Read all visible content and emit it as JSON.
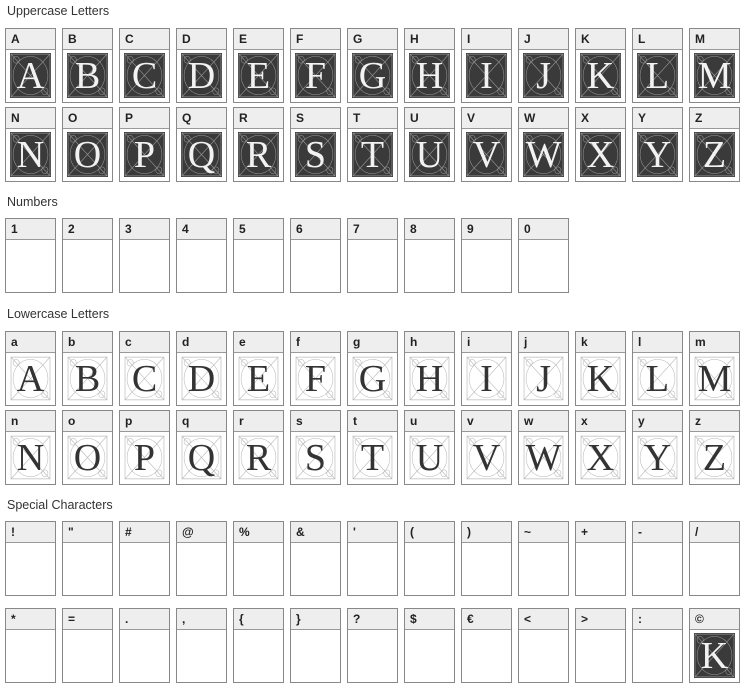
{
  "sections": [
    {
      "title": "Uppercase Letters",
      "kind": "upper",
      "cells": [
        [
          "A",
          "A"
        ],
        [
          "B",
          "B"
        ],
        [
          "C",
          "C"
        ],
        [
          "D",
          "D"
        ],
        [
          "E",
          "E"
        ],
        [
          "F",
          "F"
        ],
        [
          "G",
          "G"
        ],
        [
          "H",
          "H"
        ],
        [
          "I",
          "I"
        ],
        [
          "J",
          "J"
        ],
        [
          "K",
          "K"
        ],
        [
          "L",
          "L"
        ],
        [
          "M",
          "M"
        ],
        [
          "N",
          "N"
        ],
        [
          "O",
          "O"
        ],
        [
          "P",
          "P"
        ],
        [
          "Q",
          "Q"
        ],
        [
          "R",
          "R"
        ],
        [
          "S",
          "S"
        ],
        [
          "T",
          "T"
        ],
        [
          "U",
          "U"
        ],
        [
          "V",
          "V"
        ],
        [
          "W",
          "W"
        ],
        [
          "X",
          "X"
        ],
        [
          "Y",
          "Y"
        ],
        [
          "Z",
          "Z"
        ]
      ]
    },
    {
      "title": "Numbers",
      "kind": "empty",
      "cells": [
        [
          "1",
          ""
        ],
        [
          "2",
          ""
        ],
        [
          "3",
          ""
        ],
        [
          "4",
          ""
        ],
        [
          "5",
          ""
        ],
        [
          "6",
          ""
        ],
        [
          "7",
          ""
        ],
        [
          "8",
          ""
        ],
        [
          "9",
          ""
        ],
        [
          "0",
          ""
        ]
      ]
    },
    {
      "title": "Lowercase Letters",
      "kind": "lower",
      "cells": [
        [
          "a",
          "A"
        ],
        [
          "b",
          "B"
        ],
        [
          "c",
          "C"
        ],
        [
          "d",
          "D"
        ],
        [
          "e",
          "E"
        ],
        [
          "f",
          "F"
        ],
        [
          "g",
          "G"
        ],
        [
          "h",
          "H"
        ],
        [
          "i",
          "I"
        ],
        [
          "j",
          "J"
        ],
        [
          "k",
          "K"
        ],
        [
          "l",
          "L"
        ],
        [
          "m",
          "M"
        ],
        [
          "n",
          "N"
        ],
        [
          "o",
          "O"
        ],
        [
          "p",
          "P"
        ],
        [
          "q",
          "Q"
        ],
        [
          "r",
          "R"
        ],
        [
          "s",
          "S"
        ],
        [
          "t",
          "T"
        ],
        [
          "u",
          "U"
        ],
        [
          "v",
          "V"
        ],
        [
          "w",
          "W"
        ],
        [
          "x",
          "X"
        ],
        [
          "y",
          "Y"
        ],
        [
          "z",
          "Z"
        ]
      ]
    },
    {
      "title": "Special Characters",
      "kind": "special",
      "cells": [
        [
          "!",
          ""
        ],
        [
          "\"",
          ""
        ],
        [
          "#",
          ""
        ],
        [
          "@",
          ""
        ],
        [
          "%",
          ""
        ],
        [
          "&",
          ""
        ],
        [
          "'",
          ""
        ],
        [
          "(",
          ""
        ],
        [
          ")",
          ""
        ],
        [
          "~",
          ""
        ],
        [
          "+",
          ""
        ],
        [
          "-",
          ""
        ],
        [
          "/",
          ""
        ],
        [
          "*",
          ""
        ],
        [
          "=",
          ""
        ],
        [
          ".",
          ""
        ],
        [
          ",",
          ""
        ],
        [
          "{",
          ""
        ],
        [
          "}",
          ""
        ],
        [
          "?",
          ""
        ],
        [
          "$",
          ""
        ],
        [
          "€",
          ""
        ],
        [
          "<",
          ""
        ],
        [
          ">",
          ""
        ],
        [
          ":",
          ""
        ],
        [
          "©",
          "K"
        ]
      ]
    }
  ]
}
